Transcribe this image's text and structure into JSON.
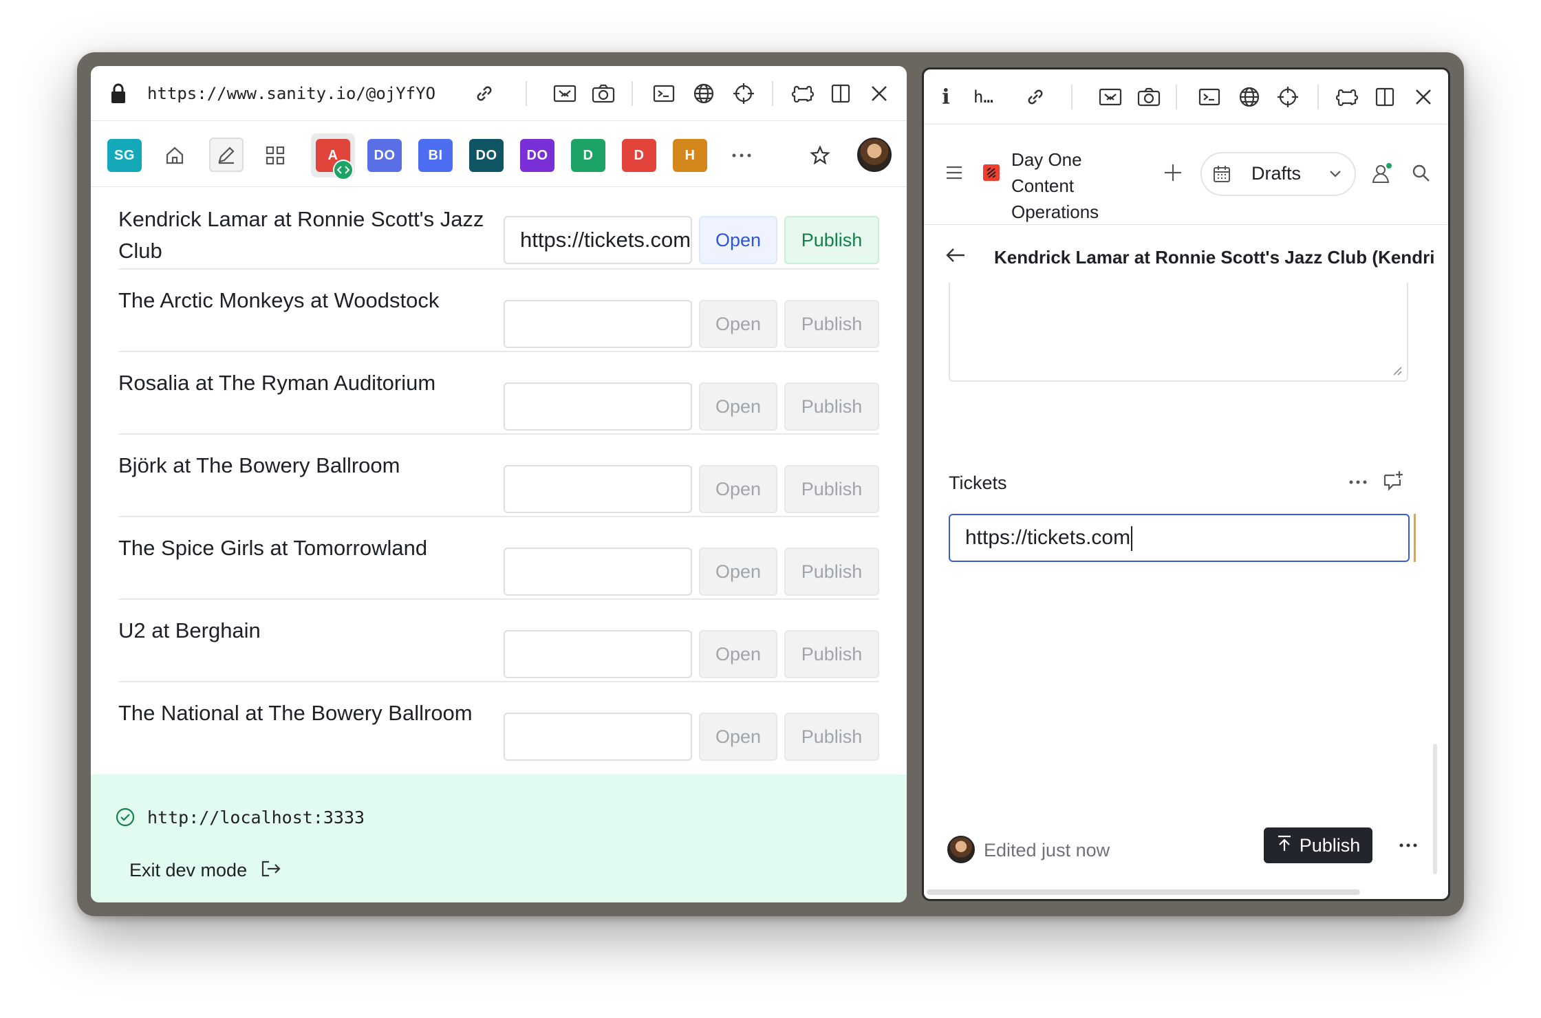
{
  "left_window": {
    "url": "https://www.sanity.io/@ojYfYOfwz/…",
    "apps": [
      {
        "label": "SG",
        "color": "#14a9b8"
      },
      {
        "label": "A",
        "color": "#e0443a"
      },
      {
        "label": "DO",
        "color": "#5a6ee6"
      },
      {
        "label": "BI",
        "color": "#4e6ef2"
      },
      {
        "label": "DO",
        "color": "#0f5563"
      },
      {
        "label": "DO",
        "color": "#7b2fd6"
      },
      {
        "label": "D",
        "color": "#1ca365"
      },
      {
        "label": "D",
        "color": "#e2433a"
      },
      {
        "label": "H",
        "color": "#d3871b"
      }
    ],
    "rows": [
      {
        "title": "Kendrick Lamar at Ronnie Scott's Jazz Club",
        "ticket": "https://tickets.com",
        "open": "Open",
        "publish": "Publish"
      },
      {
        "title": "The Arctic Monkeys at Woodstock",
        "ticket": "",
        "open": "Open",
        "publish": "Publish"
      },
      {
        "title": "Rosalia at The Ryman Auditorium",
        "ticket": "",
        "open": "Open",
        "publish": "Publish"
      },
      {
        "title": "Björk at The Bowery Ballroom",
        "ticket": "",
        "open": "Open",
        "publish": "Publish"
      },
      {
        "title": "The Spice Girls at Tomorrowland",
        "ticket": "",
        "open": "Open",
        "publish": "Publish"
      },
      {
        "title": "U2 at Berghain",
        "ticket": "",
        "open": "Open",
        "publish": "Publish"
      },
      {
        "title": "The National at The Bowery Ballroom",
        "ticket": "",
        "open": "Open",
        "publish": "Publish"
      }
    ],
    "dev": {
      "url": "http://localhost:3333",
      "exit_label": "Exit dev mode"
    }
  },
  "right_window": {
    "url_short": "h…",
    "project_line1": "Day One",
    "project_line2": "Content",
    "project_line3": "Operations",
    "release_label": "Drafts",
    "document_title": "Kendrick Lamar at Ronnie Scott's Jazz Club (Kendri",
    "field_label": "Tickets",
    "field_value": "https://tickets.com",
    "status": "Edited just now",
    "publish_label": "Publish"
  }
}
